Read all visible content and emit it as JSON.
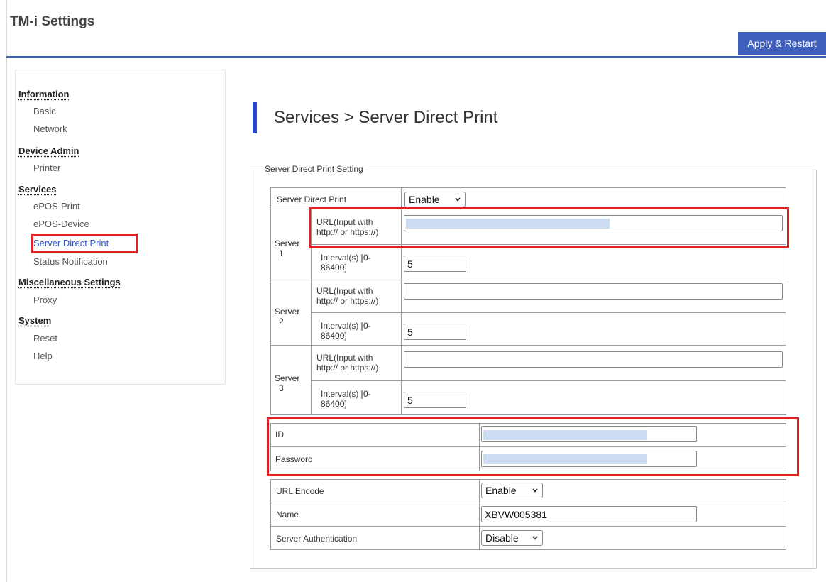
{
  "app_title": "TM-i Settings",
  "header": {
    "apply_label": "Apply & Restart"
  },
  "sidebar": {
    "groups": [
      {
        "label": "Information",
        "items": [
          "Basic",
          "Network"
        ]
      },
      {
        "label": "Device Admin",
        "items": [
          "Printer"
        ]
      },
      {
        "label": "Services",
        "items": [
          "ePOS-Print",
          "ePOS-Device",
          "Server Direct Print",
          "Status Notification"
        ]
      },
      {
        "label": "Miscellaneous Settings",
        "items": [
          "Proxy"
        ]
      },
      {
        "label": "System",
        "items": [
          "Reset",
          "Help"
        ]
      }
    ],
    "active_item": "Server Direct Print"
  },
  "page_title": "Services > Server Direct Print",
  "form": {
    "legend": "Server Direct Print Setting",
    "server_direct_print": {
      "label": "Server Direct Print",
      "value": "Enable"
    },
    "url_label_line1": "URL(Input with",
    "url_label_line2": "http:// or https://)",
    "interval_label_line1": "Interval(s) [0-",
    "interval_label_line2": "86400]",
    "servers": [
      {
        "label_line1": "Server",
        "label_line2": "1",
        "url": "",
        "interval": "5"
      },
      {
        "label_line1": "Server",
        "label_line2": "2",
        "url": "",
        "interval": "5"
      },
      {
        "label_line1": "Server",
        "label_line2": "3",
        "url": "",
        "interval": "5"
      }
    ],
    "id": {
      "label": "ID",
      "value": ""
    },
    "password": {
      "label": "Password",
      "value": ""
    },
    "url_encode": {
      "label": "URL Encode",
      "value": "Enable"
    },
    "name": {
      "label": "Name",
      "value": "XBVW005381"
    },
    "server_authentication": {
      "label": "Server Authentication",
      "value": "Disable"
    }
  },
  "colors": {
    "accent": "#3e5fbb",
    "title_bar": "#2548c9",
    "highlight": "#e02020",
    "active_link": "#2f57d0",
    "redaction": "#ccdcf2"
  }
}
